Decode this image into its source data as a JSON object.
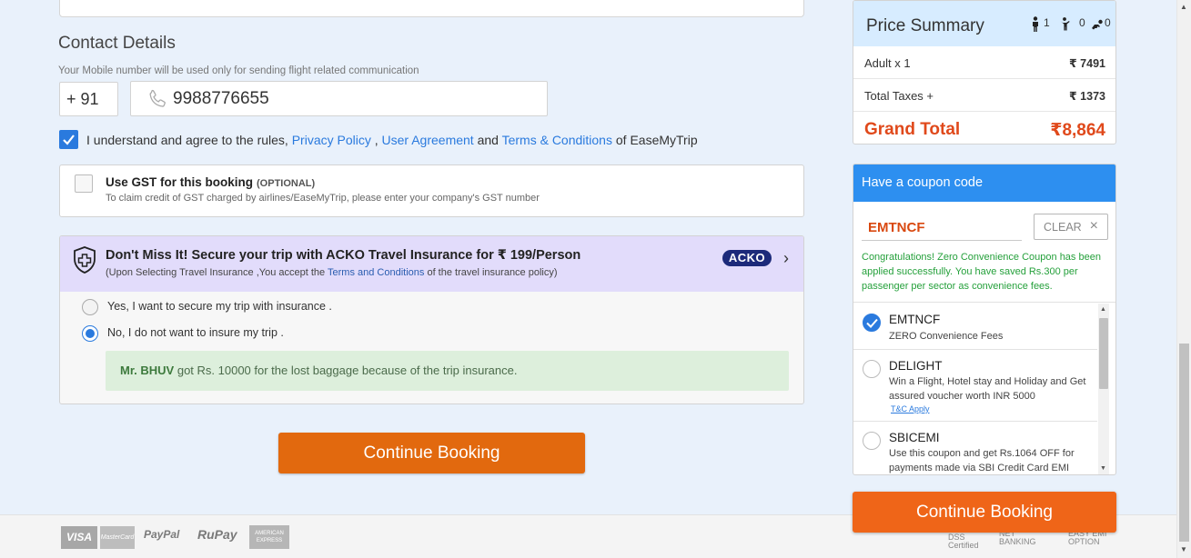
{
  "contact": {
    "title": "Contact Details",
    "subtitle": "Your Mobile number will be used only for sending flight related communication",
    "country_code": "+ 91",
    "phone": "9988776655"
  },
  "agree": {
    "text_1": "I understand and agree to the rules, ",
    "privacy": "Privacy Policy",
    "sep": " , ",
    "user_agreement": "User Agreement",
    "and": " and ",
    "terms": "Terms & Conditions",
    "suffix": " of EaseMyTrip",
    "checked": true
  },
  "gst": {
    "title": "Use GST for this booking",
    "optional": "(OPTIONAL)",
    "subtitle": "To claim credit of GST charged by airlines/EaseMyTrip, please enter your company's GST number",
    "checked": false
  },
  "insurance": {
    "title": "Don't Miss It! Secure your trip with ACKO Travel Insurance for ₹ 199/Person",
    "sub_1": "(Upon Selecting Travel Insurance ,You accept the ",
    "sub_link": "Terms and Conditions",
    "sub_2": " of the travel insurance policy)",
    "brand": "ACKO",
    "option_yes": "Yes, I want to secure my trip with insurance .",
    "option_no": "No, I do not want to insure my trip .",
    "selected": "no",
    "banner_name": "Mr. BHUV",
    "banner_text": " got Rs. 10000 for the lost baggage because of the trip insurance."
  },
  "continue_main": "Continue Booking",
  "footer": {
    "visa": "VISA",
    "mastercard": "MasterCard",
    "paypal": "PayPal",
    "rupay": "RuPay",
    "amex": "AMERICAN EXPRESS",
    "dss": "DSS",
    "dss_sub": "Certified",
    "net_banking_1": "NET",
    "net_banking_2": "BANKING",
    "emi_1": "EASY EMI",
    "emi_2": "OPTION"
  },
  "price": {
    "title": "Price Summary",
    "adults": "1",
    "children": "0",
    "infants": "0",
    "rows": [
      {
        "label": "Adult x 1",
        "value": "₹ 7491"
      },
      {
        "label": "Total Taxes +",
        "value": "₹ 1373"
      }
    ],
    "grand_label": "Grand Total",
    "grand_value": "₹8,864"
  },
  "coupon": {
    "title": "Have a coupon code",
    "code": "EMTNCF",
    "clear": "CLEAR",
    "message": "Congratulations! Zero Convenience Coupon has been applied successfully. You have saved Rs.300 per passenger per sector as convenience fees.",
    "items": [
      {
        "code": "EMTNCF",
        "desc": "ZERO Convenience Fees",
        "selected": true
      },
      {
        "code": "DELIGHT",
        "desc": "Win a Flight, Hotel stay and Holiday and Get assured voucher worth INR 5000",
        "tc": "T&C Apply",
        "selected": false
      },
      {
        "code": "SBICEMI",
        "desc": "Use this coupon and get Rs.1064 OFF for payments made via SBI Credit Card EMI",
        "selected": false
      }
    ]
  },
  "continue_side": "Continue Booking",
  "colors": {
    "accent_blue": "#2a7ade",
    "orange": "#e2690e",
    "grand_total": "#e0491b",
    "coupon_header": "#2d8ff0",
    "success_green": "#25a03b"
  }
}
